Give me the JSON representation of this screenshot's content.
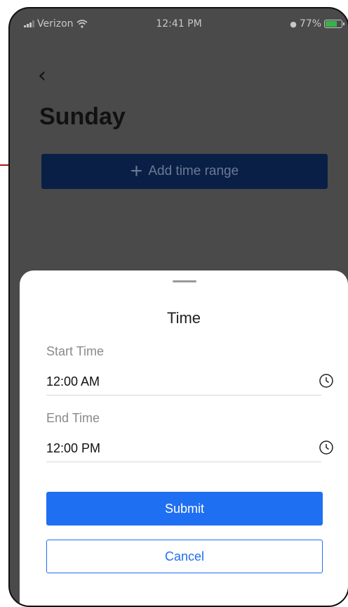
{
  "status_bar": {
    "carrier": "Verizon",
    "time": "12:41 PM",
    "battery_percent_label": "77%",
    "battery_level": 0.77,
    "wifi_icon": "wifi-icon",
    "signal_icon": "signal-icon",
    "battery_icon": "battery-charging-icon"
  },
  "header": {
    "back_icon": "chevron-left-icon",
    "title": "Sunday"
  },
  "add_range_button": {
    "icon": "plus-icon",
    "label": "Add time range"
  },
  "time_sheet": {
    "title": "Time",
    "start": {
      "label": "Start Time",
      "value": "12:00 AM",
      "icon": "clock-icon"
    },
    "end": {
      "label": "End Time",
      "value": "12:00 PM",
      "icon": "clock-icon"
    },
    "submit_label": "Submit",
    "cancel_label": "Cancel"
  },
  "colors": {
    "overlay": "#4a4a4a",
    "primary": "#1f6ff2",
    "annotation_arrow": "#b01515"
  }
}
